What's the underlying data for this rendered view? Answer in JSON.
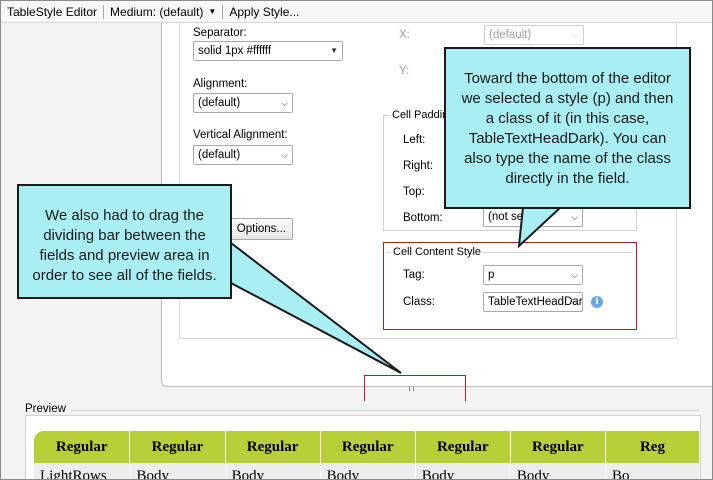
{
  "toolbar": {
    "title": "TableStyle Editor",
    "medium_label": "Medium: (default)",
    "apply_label": "Apply Style..."
  },
  "editor": {
    "separator": {
      "label": "Separator:",
      "value": "solid 1px #ffffff"
    },
    "alignment": {
      "label": "Alignment:",
      "value": "(default)"
    },
    "vertical_alignment": {
      "label": "Vertical Alignment:",
      "value": "(default)"
    },
    "options_button": "Options...",
    "x": {
      "label": "X:",
      "value": "(default)"
    },
    "y": {
      "label": "Y:"
    },
    "cell_padding": {
      "title": "Cell Paddin",
      "left_label": "Left:",
      "right_label": "Right:",
      "top_label": "Top:",
      "bottom_label": "Bottom:",
      "bottom_value": "(not set)"
    },
    "cell_content_style": {
      "title": "Cell Content Style",
      "tag_label": "Tag:",
      "tag_value": "p",
      "class_label": "Class:",
      "class_value": "TableTextHeadDark",
      "info_icon": "i"
    }
  },
  "callouts": {
    "top_right": [
      "Toward the bottom of the editor",
      "we selected a style (p) and then",
      "a class of it (in this case,",
      "TableTextHeadDark). You can",
      "also type the name of the class",
      "directly in the field."
    ],
    "left": [
      "We also had to drag the",
      "dividing bar between the",
      "fields and preview area in",
      "order to see all of the fields."
    ]
  },
  "preview": {
    "label": "Preview",
    "headers": [
      "Regular",
      "Regular",
      "Regular",
      "Regular",
      "Regular",
      "Regular",
      "Reg"
    ],
    "row": [
      "LightRows",
      "Body",
      "Body",
      "Body",
      "Body",
      "Body",
      "Bo"
    ]
  },
  "icons": {
    "dropdown": "chevron-down-icon",
    "info": "info-icon",
    "grip": "splitter-grip-icon"
  },
  "colors": {
    "callout_fill": "#a9eef3",
    "highlight_border": "#b21f24",
    "header_green": "#b8cf37",
    "info_blue": "#6aa7e8"
  }
}
